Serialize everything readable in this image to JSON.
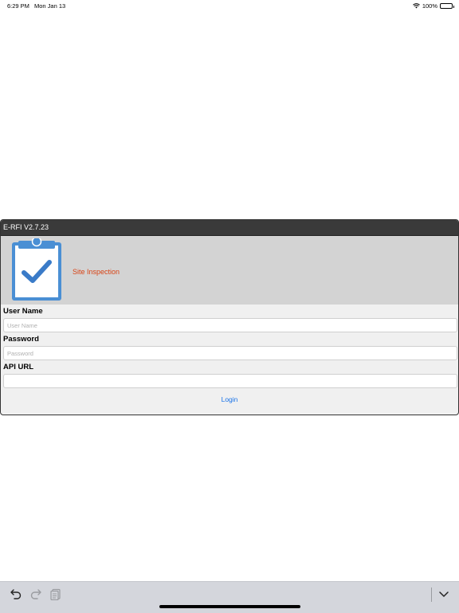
{
  "status_bar": {
    "time": "6:29 PM",
    "date": "Mon Jan 13",
    "battery": "100%"
  },
  "dialog": {
    "title": "E-RFI V2.7.23",
    "banner_text": "Site Inspection",
    "banner_icon": "clipboard-check-icon",
    "accent_color": "#d84315",
    "fields": {
      "username": {
        "label": "User Name",
        "placeholder": "User Name",
        "value": ""
      },
      "password": {
        "label": "Password",
        "placeholder": "Password",
        "value": ""
      },
      "api_url": {
        "label": "API URL",
        "placeholder": "",
        "value": ""
      }
    },
    "login_label": "Login",
    "link_color": "#1a73e8"
  },
  "keyboard_toolbar": {
    "buttons": [
      "undo-icon",
      "redo-icon",
      "paste-icon",
      "chevron-down-icon"
    ]
  }
}
